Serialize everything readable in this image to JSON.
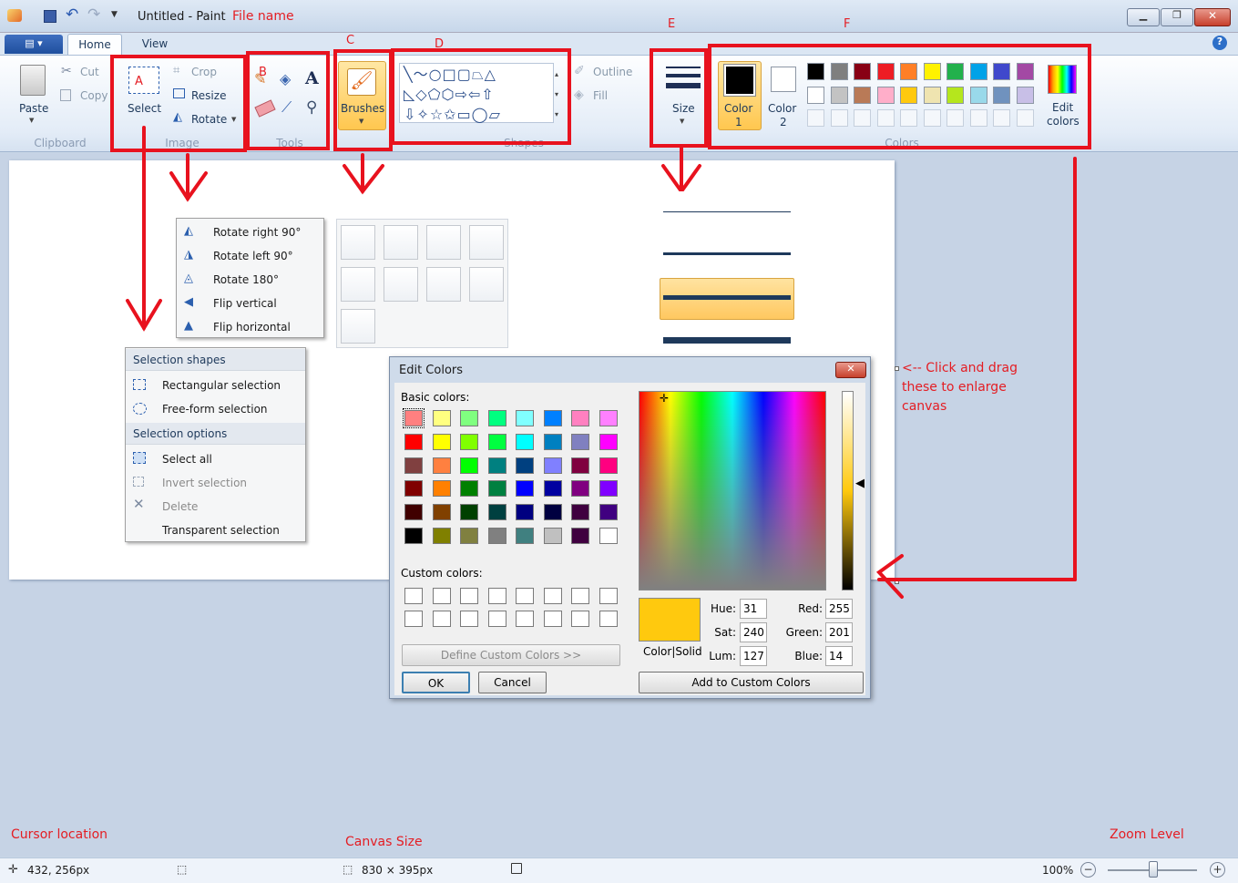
{
  "window": {
    "title": "Untitled - Paint",
    "annotation": "File name"
  },
  "tabs": [
    {
      "label": "Home"
    },
    {
      "label": "View"
    }
  ],
  "ribbon": {
    "clipboard": {
      "paste": "Paste",
      "cut": "Cut",
      "copy": "Copy",
      "group": "Clipboard"
    },
    "image": {
      "select": "Select",
      "crop": "Crop",
      "resize": "Resize",
      "rotate": "Rotate",
      "group": "Image"
    },
    "tools": {
      "group": "Tools"
    },
    "brushes": {
      "label": "Brushes"
    },
    "shapes": {
      "outline": "Outline",
      "fill": "Fill",
      "group": "Shapes"
    },
    "size": {
      "label": "Size"
    },
    "colors": {
      "color1": "Color",
      "color1_n": "1",
      "color2": "Color",
      "color2_n": "2",
      "edit_colors": "Edit",
      "edit_colors2": "colors",
      "group": "Colors",
      "palette_row1": [
        "#000000",
        "#7f7f7f",
        "#880015",
        "#ed1c24",
        "#ff7f27",
        "#fff200",
        "#22b14c",
        "#00a2e8",
        "#3f48cc",
        "#a349a4"
      ],
      "palette_row2": [
        "#ffffff",
        "#c3c3c3",
        "#b97a57",
        "#ffaec9",
        "#ffc90e",
        "#efe4b0",
        "#b5e61d",
        "#99d9ea",
        "#7092be",
        "#c8bfe7"
      ]
    }
  },
  "annotations": {
    "a": "A",
    "b": "B",
    "c": "C",
    "d": "D",
    "e": "E",
    "f": "F",
    "drag_hint_1": "<-- Click and drag",
    "drag_hint_2": "these to enlarge",
    "drag_hint_3": "canvas",
    "cursor_location": "Cursor location",
    "canvas_size": "Canvas Size",
    "zoom_level": "Zoom Level"
  },
  "rotate_menu": [
    "Rotate right 90°",
    "Rotate left 90°",
    "Rotate 180°",
    "Flip vertical",
    "Flip horizontal"
  ],
  "select_menu": {
    "section1": "Selection shapes",
    "shapes": [
      "Rectangular selection",
      "Free-form selection"
    ],
    "section2": "Selection options",
    "options": [
      "Select all",
      "Invert selection",
      "Delete",
      "Transparent selection"
    ]
  },
  "edit_colors": {
    "title": "Edit Colors",
    "basic_label": "Basic colors:",
    "custom_label": "Custom colors:",
    "define_button": "Define Custom Colors >>",
    "ok": "OK",
    "cancel": "Cancel",
    "color_solid": "Color|Solid",
    "hue_label": "Hue:",
    "hue": "31",
    "sat_label": "Sat:",
    "sat": "240",
    "lum_label": "Lum:",
    "lum": "127",
    "red_label": "Red:",
    "red": "255",
    "green_label": "Green:",
    "green": "201",
    "blue_label": "Blue:",
    "blue": "14",
    "add_button": "Add to Custom Colors",
    "current_color": "#ffc90e",
    "basic_colors": [
      [
        "#ff8080",
        "#ffff80",
        "#80ff80",
        "#00ff80",
        "#80ffff",
        "#0080ff",
        "#ff80c0",
        "#ff80ff"
      ],
      [
        "#ff0000",
        "#ffff00",
        "#80ff00",
        "#00ff40",
        "#00ffff",
        "#0080c0",
        "#8080c0",
        "#ff00ff"
      ],
      [
        "#804040",
        "#ff8040",
        "#00ff00",
        "#008080",
        "#004080",
        "#8080ff",
        "#800040",
        "#ff0080"
      ],
      [
        "#800000",
        "#ff8000",
        "#008000",
        "#008040",
        "#0000ff",
        "#0000a0",
        "#800080",
        "#8000ff"
      ],
      [
        "#400000",
        "#804000",
        "#004000",
        "#004040",
        "#000080",
        "#000040",
        "#400040",
        "#400080"
      ],
      [
        "#000000",
        "#808000",
        "#808040",
        "#808080",
        "#408080",
        "#c0c0c0",
        "#400040",
        "#ffffff"
      ]
    ]
  },
  "status": {
    "cursor": "432, 256px",
    "canvas_size": "830 × 395px",
    "zoom": "100%"
  }
}
